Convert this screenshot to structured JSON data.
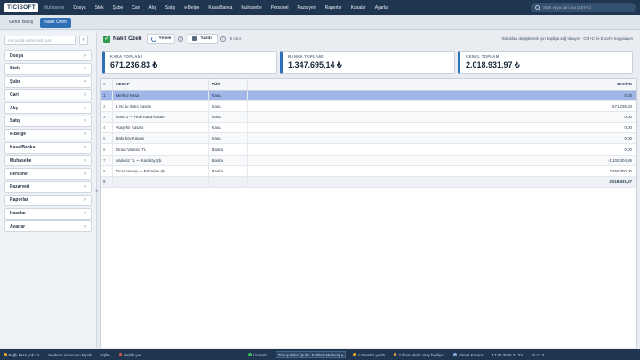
{
  "app": {
    "brand": "TİCİSOFT",
    "subtitle": "Muhasebe"
  },
  "menu": [
    "Dosya",
    "Stok",
    "Şube",
    "Cari",
    "Alış",
    "Satış",
    "e-Belge",
    "Kasa/Banka",
    "Muhasebe",
    "Personel",
    "Pazaryeri",
    "Raporlar",
    "Kasalar",
    "Ayarlar"
  ],
  "search": {
    "placeholder": "Stok veya cari ara (Ctrl+K)"
  },
  "tabs": [
    "Genel Bakış",
    "Nakit Özeti"
  ],
  "sidebar": {
    "search_placeholder": "Ara ya da ekran kodu yaz",
    "collapse": "«",
    "items": [
      "Dosya",
      "Stok",
      "Şube",
      "Cari",
      "Alış",
      "Satış",
      "e-Belge",
      "Kasa/Banka",
      "Muhasebe",
      "Personel",
      "Pazaryeri",
      "Raporlar",
      "Kasalar",
      "Ayarlar"
    ]
  },
  "toolbar": {
    "title": "Nakit Özeti",
    "refresh": "Yenile",
    "print": "Yazdır",
    "row_count": "8 satır",
    "hint": "Sütunları değiştirmek için başlığa sağ tıklayın · Ctrl+C ile Excel'e kopyalayın"
  },
  "cards": [
    {
      "label": "KASA TOPLAMI",
      "value": "671.236,83 ₺"
    },
    {
      "label": "BANKA TOPLAMI",
      "value": "1.347.695,14 ₺"
    },
    {
      "label": "GENEL TOPLAM",
      "value": "2.018.931,97 ₺"
    }
  ],
  "table": {
    "headers": {
      "idx": "#",
      "name": "HESAP",
      "type": "TÜR",
      "balance": "BAKİYE"
    },
    "rows": [
      {
        "idx": "1",
        "name": "Merkez Kasa",
        "type": "Kasa",
        "balance": "0,00"
      },
      {
        "idx": "2",
        "name": "1 No.lu Satış Kasası",
        "type": "Kasa",
        "balance": "671.236,83"
      },
      {
        "idx": "3",
        "name": "Kasa 2 — Hızlı Kasa Kasası",
        "type": "Kasa",
        "balance": "0,00"
      },
      {
        "idx": "4",
        "name": "Ataşehir Kasası",
        "type": "Kasa",
        "balance": "0,00"
      },
      {
        "idx": "5",
        "name": "Bakırköy Kasası",
        "type": "Kasa",
        "balance": "0,00"
      },
      {
        "idx": "6",
        "name": "Ziraat Vadesiz TL",
        "type": "Banka",
        "balance": "0,00"
      },
      {
        "idx": "7",
        "name": "Vadesiz TL — Kadıköy Şb.",
        "type": "Banka",
        "balance": "-1.102.304,86"
      },
      {
        "idx": "8",
        "name": "Ticari Hesap — Bahariye Şb.",
        "type": "Banka",
        "balance": "2.450.000,00"
      }
    ],
    "total": {
      "idx": "8",
      "balance": "2.018.931,97"
    }
  },
  "status": {
    "left1": "Bağlı kasa yok / 3",
    "left2": "Senkron sunucusu kapalı",
    "left3": "sqlite",
    "left4": "Yedek yok",
    "license": "Lisanslı",
    "branch": "Tüm şubeler (Şube: Kadıköy Merkez)",
    "transfer": "1 transfer yolda",
    "pending": "2 ilmot talebi onay bekliyor",
    "user": "Ahmet Karaca",
    "datetime": "17.05.2026 21:23",
    "version": "v2.12.3"
  },
  "colors": {
    "nav": "#1f3550",
    "accent": "#2f6fb6",
    "selected_row": "#9fb6e6",
    "ok": "#2e9a4a"
  }
}
